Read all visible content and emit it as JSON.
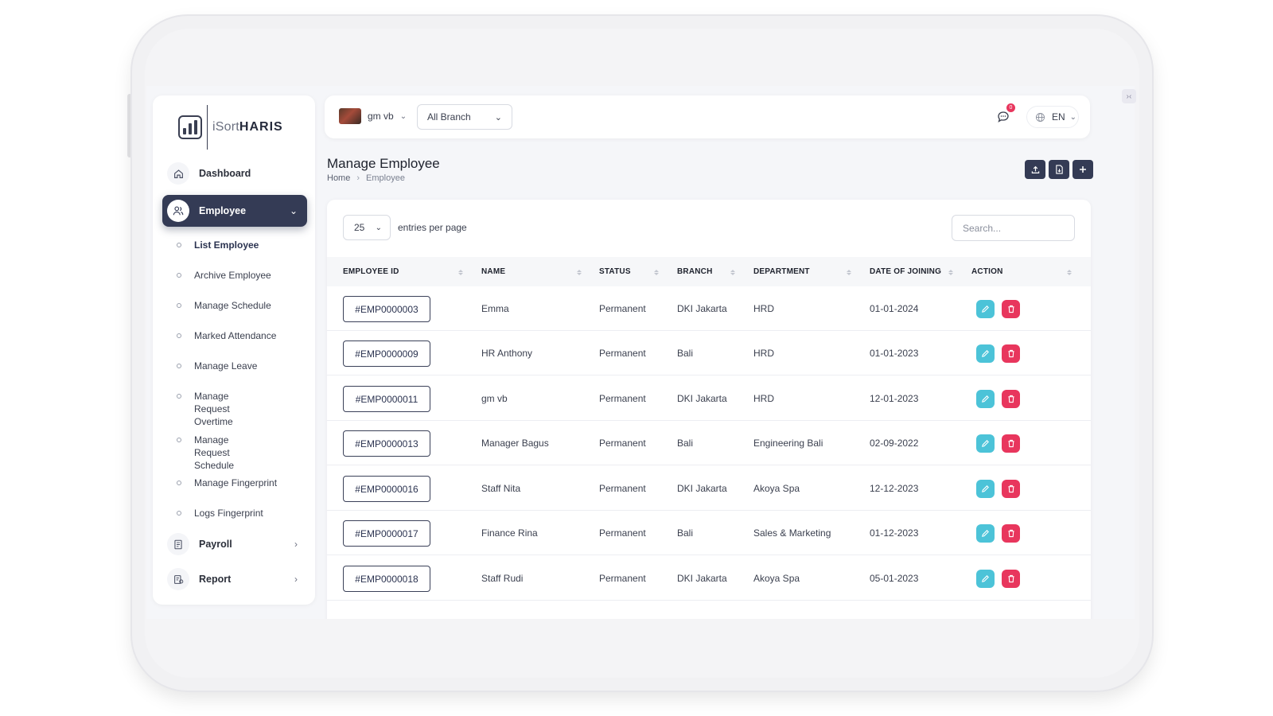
{
  "sidebar": {
    "logo": {
      "prefix": "iSort",
      "brand": "HARIS"
    },
    "items": [
      {
        "label": "Dashboard",
        "icon": "home-icon"
      },
      {
        "label": "Employee",
        "icon": "users-icon",
        "expanded": true
      },
      {
        "label": "Payroll",
        "icon": "document-icon"
      },
      {
        "label": "Report",
        "icon": "report-icon"
      }
    ],
    "submenu": [
      "List Employee",
      "Archive Employee",
      "Manage Schedule",
      "Marked Attendance",
      "Manage Leave",
      "Manage Request Overtime",
      "Manage Request Schedule",
      "Manage Fingerprint",
      "Logs Fingerprint"
    ]
  },
  "topbar": {
    "user": "gm vb",
    "branch": "All Branch",
    "notifications": "0",
    "language": "EN"
  },
  "page": {
    "title": "Manage Employee",
    "breadcrumb": {
      "home": "Home",
      "current": "Employee"
    },
    "actions": [
      "upload-icon",
      "file-icon",
      "plus-icon"
    ]
  },
  "table": {
    "entries_value": "25",
    "entries_label": "entries per page",
    "search_placeholder": "Search...",
    "columns": [
      "EMPLOYEE ID",
      "NAME",
      "STATUS",
      "BRANCH",
      "DEPARTMENT",
      "DATE OF JOINING",
      "ACTION"
    ],
    "rows": [
      {
        "id": "#EMP0000003",
        "name": "Emma",
        "status": "Permanent",
        "branch": "DKI Jakarta",
        "department": "HRD",
        "joined": "01-01-2024"
      },
      {
        "id": "#EMP0000009",
        "name": "HR Anthony",
        "status": "Permanent",
        "branch": "Bali",
        "department": "HRD",
        "joined": "01-01-2023"
      },
      {
        "id": "#EMP0000011",
        "name": "gm vb",
        "status": "Permanent",
        "branch": "DKI Jakarta",
        "department": "HRD",
        "joined": "12-01-2023"
      },
      {
        "id": "#EMP0000013",
        "name": "Manager Bagus",
        "status": "Permanent",
        "branch": "Bali",
        "department": "Engineering Bali",
        "joined": "02-09-2022"
      },
      {
        "id": "#EMP0000016",
        "name": "Staff Nita",
        "status": "Permanent",
        "branch": "DKI Jakarta",
        "department": "Akoya Spa",
        "joined": "12-12-2023"
      },
      {
        "id": "#EMP0000017",
        "name": "Finance Rina",
        "status": "Permanent",
        "branch": "Bali",
        "department": "Sales & Marketing",
        "joined": "01-12-2023"
      },
      {
        "id": "#EMP0000018",
        "name": "Staff Rudi",
        "status": "Permanent",
        "branch": "DKI Jakarta",
        "department": "Akoya Spa",
        "joined": "05-01-2023"
      }
    ]
  },
  "colors": {
    "primary": "#343b55",
    "edit": "#4cc3d8",
    "delete": "#e8365d",
    "background": "#f5f6f9"
  }
}
